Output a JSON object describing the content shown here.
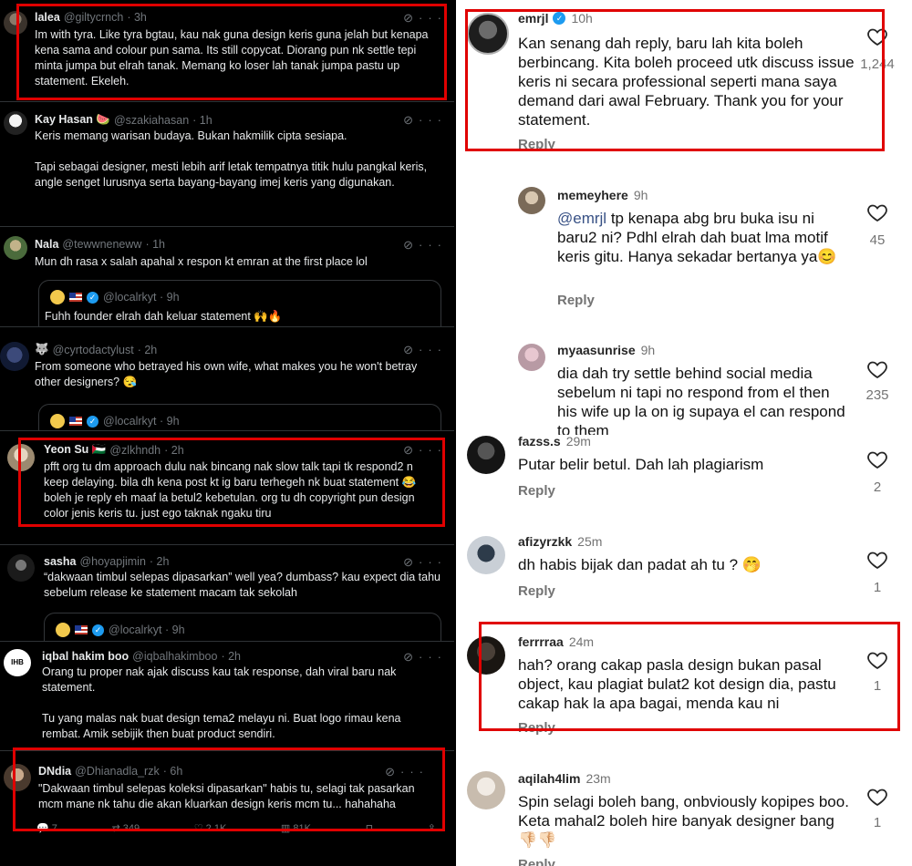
{
  "twitter": {
    "tweets": [
      {
        "name": "lalea",
        "handle": "@giltycrnch",
        "time": "· 3h",
        "text": "Im with tyra. Like tyra bgtau, kau nak guna design keris guna jelah but kenapa kena sama and colour pun sama. Its still copycat. Diorang pun nk settle tepi minta jumpa but elrah tanak. Memang ko loser lah tanak jumpa pastu up statement. Ekeleh."
      },
      {
        "name": "Kay Hasan 🍉",
        "handle": "@szakiahasan",
        "time": "· 1h",
        "text": "Keris memang warisan budaya. Bukan hakmilik cipta sesiapa.\n\nTapi sebagai designer, mesti lebih arif letak tempatnya titik hulu pangkal keris, angle senget lurusnya serta bayang-bayang imej keris yang digunakan."
      },
      {
        "name": "Nala",
        "handle": "@tewwneneww",
        "time": "· 1h",
        "text": "Mun dh rasa x salah apahal x respon kt emran at the first place lol",
        "quote_handle": "@localrkyt · 9h",
        "quote_text": "Fuhh founder elrah dah keluar statement 🙌🔥"
      },
      {
        "name": "🐺",
        "handle": "@cyrtodactylust",
        "time": "· 2h",
        "text": "From someone who betrayed his own wife, what makes you he won't betray other designers? 😪",
        "quote_handle": "@localrkyt · 9h"
      },
      {
        "name": "Yeon Su 🇵🇸",
        "handle": "@zlkhndh",
        "time": "· 2h",
        "text": "pfft org tu dm approach dulu nak bincang nak slow talk tapi tk respond2 n keep delaying. bila dh kena post kt ig baru terhegeh nk buat statement 😂 boleh je reply eh maaf la betul2 kebetulan. org tu dh copyright pun design color jenis keris tu. just ego taknak ngaku tiru"
      },
      {
        "name": "sasha",
        "handle": "@hoyapjimin",
        "time": "· 2h",
        "text": "“dakwaan timbul selepas dipasarkan” well yea? dumbass? kau expect dia tahu sebelum release ke statement macam tak sekolah",
        "quote_handle": "@localrkyt · 9h"
      },
      {
        "name": "iqbal hakim boo",
        "handle": "@iqbalhakimboo",
        "time": "· 2h",
        "text": "Orang tu proper nak ajak discuss kau tak response, dah viral baru nak statement.\n\nTu yang malas nak buat design tema2 melayu ni. Buat logo rimau kena rembat. Amik sebijik then buat product sendiri."
      },
      {
        "name": "DNdia",
        "handle": "@Dhianadla_rzk",
        "time": "· 6h",
        "text": "\"Dakwaan timbul selepas koleksi dipasarkan\" habis tu, selagi tak pasarkan mcm mane nk tahu die akan kluarkan design keris mcm tu... hahahaha",
        "actions": [
          "7",
          "349",
          "2.1K",
          "81K"
        ]
      }
    ]
  },
  "instagram": {
    "reply_label": "Reply",
    "comments": [
      {
        "user": "emrjl",
        "verified": true,
        "time": "10h",
        "text": "Kan senang dah reply, baru lah kita boleh berbincang. Kita boleh proceed utk discuss issue keris ni secara professional seperti mana saya demand dari awal February. Thank you for your statement.",
        "likes": "1,244"
      },
      {
        "user": "memeyhere",
        "time": "9h",
        "mention": "@emrjl",
        "text": " tp kenapa abg bru buka isu ni baru2 ni? Pdhl elrah dah buat lma motif keris gitu. Hanya sekadar bertanya ya😊",
        "likes": "45"
      },
      {
        "user": "myaasunrise",
        "time": "9h",
        "text": "dia dah try settle behind social media sebelum ni tapi no respond from el then his wife up la on ig supaya el can respond to them",
        "likes": "235"
      },
      {
        "user": "fazss.s",
        "time": "29m",
        "text": "Putar belir betul. Dah lah plagiarism",
        "likes": "2"
      },
      {
        "user": "afizyrzkk",
        "time": "25m",
        "text": "dh habis bijak dan padat ah tu ? 🤭",
        "likes": "1"
      },
      {
        "user": "ferrrraa",
        "time": "24m",
        "text": "hah? orang cakap pasla design bukan pasal object, kau plagiat bulat2 kot design dia, pastu cakap hak la apa bagai, menda kau ni",
        "likes": "1"
      },
      {
        "user": "aqilah4lim",
        "time": "23m",
        "text": "Spin selagi boleh bang, onbviously kopipes boo. Keta mahal2 boleh hire banyak designer bang 👎🏻👎🏻",
        "likes": "1"
      }
    ]
  },
  "colors": {
    "highlight": "#e00000",
    "twitter_bg": "#000000",
    "twitter_muted": "#71767b",
    "ig_mention": "#385185",
    "ig_muted": "#737373",
    "verified": "#1d9bf0"
  }
}
